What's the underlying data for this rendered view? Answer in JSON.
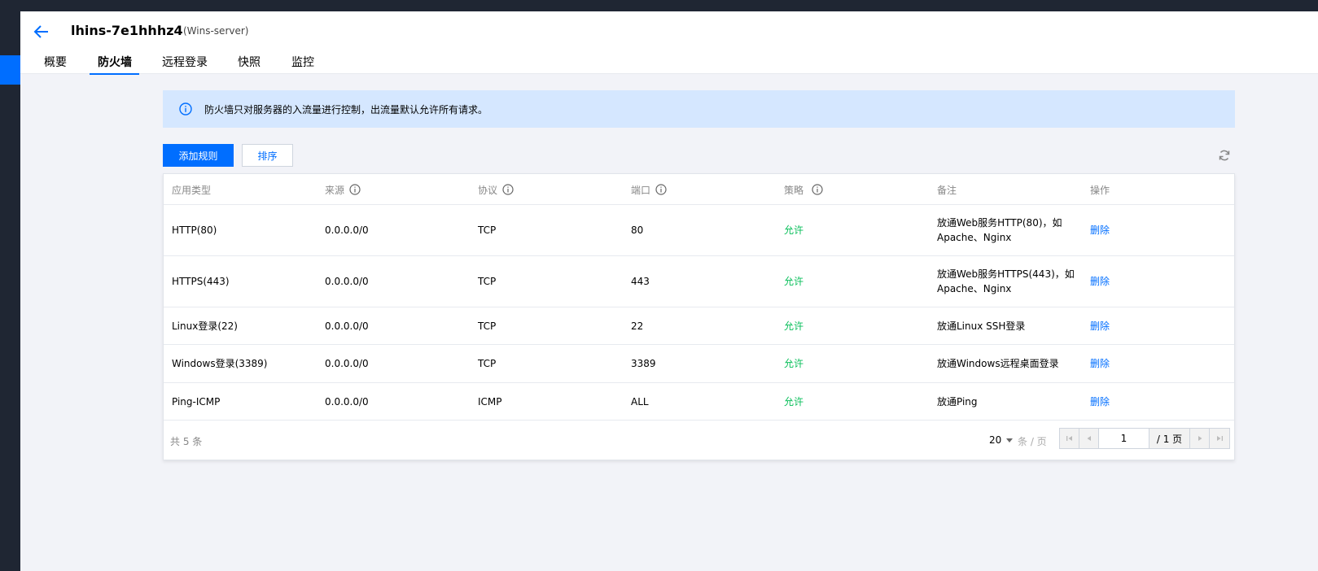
{
  "header": {
    "title": "lhins-7e1hhhz4",
    "subtitle": "(Wins-server)"
  },
  "tabs": [
    {
      "label": "概要"
    },
    {
      "label": "防火墙",
      "active": true
    },
    {
      "label": "远程登录"
    },
    {
      "label": "快照"
    },
    {
      "label": "监控"
    }
  ],
  "notice": {
    "text": "防火墙只对服务器的入流量进行控制，出流量默认允许所有请求。"
  },
  "toolbar": {
    "add_rule_label": "添加规则",
    "sort_label": "排序"
  },
  "table": {
    "columns": [
      "应用类型",
      "来源",
      "协议",
      "端口",
      "策略",
      "备注",
      "操作"
    ],
    "rows": [
      {
        "app": "HTTP(80)",
        "source": "0.0.0.0/0",
        "protocol": "TCP",
        "port": "80",
        "policy": "允许",
        "note": "放通Web服务HTTP(80)，如Apache、Nginx",
        "action": "删除"
      },
      {
        "app": "HTTPS(443)",
        "source": "0.0.0.0/0",
        "protocol": "TCP",
        "port": "443",
        "policy": "允许",
        "note": "放通Web服务HTTPS(443)，如Apache、Nginx",
        "action": "删除"
      },
      {
        "app": "Linux登录(22)",
        "source": "0.0.0.0/0",
        "protocol": "TCP",
        "port": "22",
        "policy": "允许",
        "note": "放通Linux SSH登录",
        "action": "删除"
      },
      {
        "app": "Windows登录(3389)",
        "source": "0.0.0.0/0",
        "protocol": "TCP",
        "port": "3389",
        "policy": "允许",
        "note": "放通Windows远程桌面登录",
        "action": "删除"
      },
      {
        "app": "Ping-ICMP",
        "source": "0.0.0.0/0",
        "protocol": "ICMP",
        "port": "ALL",
        "policy": "允许",
        "note": "放通Ping",
        "action": "删除"
      }
    ]
  },
  "footer": {
    "total_text": "共 5 条",
    "page_size": "20",
    "per_page_label": "条 / 页",
    "current_page": "1",
    "total_pages_text": "/ 1 页"
  },
  "colors": {
    "accent": "#006eff",
    "allow": "#0abf5b",
    "notice_bg": "#d5e7ff",
    "sidebar": "#1f2633"
  }
}
